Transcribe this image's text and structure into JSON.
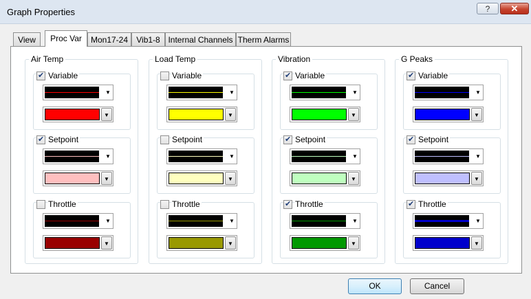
{
  "window": {
    "title": "Graph Properties",
    "help_glyph": "?",
    "close_glyph": "✕"
  },
  "tabs": [
    {
      "label": "View",
      "active": false
    },
    {
      "label": "Proc Var",
      "active": true
    },
    {
      "label": "Mon17-24",
      "active": false
    },
    {
      "label": "Vib1-8",
      "active": false
    },
    {
      "label": "Internal Channels",
      "active": false
    },
    {
      "label": "Therm Alarms",
      "active": false
    }
  ],
  "groups": [
    {
      "label": "Air Temp",
      "rows": [
        {
          "label": "Variable",
          "checked": true,
          "line_color": "#ff0000",
          "line_thickness": 1,
          "fill_color": "#ff0000"
        },
        {
          "label": "Setpoint",
          "checked": true,
          "line_color": "#ffbfbf",
          "line_thickness": 1,
          "fill_color": "#ffbfbf"
        },
        {
          "label": "Throttle",
          "checked": false,
          "line_color": "#990000",
          "line_thickness": 1,
          "fill_color": "#990000"
        }
      ]
    },
    {
      "label": "Load Temp",
      "rows": [
        {
          "label": "Variable",
          "checked": false,
          "line_color": "#ffff00",
          "line_thickness": 1,
          "fill_color": "#ffff00"
        },
        {
          "label": "Setpoint",
          "checked": false,
          "line_color": "#ffffbf",
          "line_thickness": 1,
          "fill_color": "#ffffbf"
        },
        {
          "label": "Throttle",
          "checked": false,
          "line_color": "#999900",
          "line_thickness": 1,
          "fill_color": "#999900"
        }
      ]
    },
    {
      "label": "Vibration",
      "rows": [
        {
          "label": "Variable",
          "checked": true,
          "line_color": "#00ff00",
          "line_thickness": 1,
          "fill_color": "#00ff00"
        },
        {
          "label": "Setpoint",
          "checked": true,
          "line_color": "#bfffbf",
          "line_thickness": 1,
          "fill_color": "#bfffbf"
        },
        {
          "label": "Throttle",
          "checked": true,
          "line_color": "#009900",
          "line_thickness": 1,
          "fill_color": "#009900"
        }
      ]
    },
    {
      "label": "G Peaks",
      "rows": [
        {
          "label": "Variable",
          "checked": true,
          "line_color": "#0000ff",
          "line_thickness": 1,
          "fill_color": "#0000ff"
        },
        {
          "label": "Setpoint",
          "checked": true,
          "line_color": "#bfbfff",
          "line_thickness": 1,
          "fill_color": "#bfbfff"
        },
        {
          "label": "Throttle",
          "checked": true,
          "line_color": "#0000cc",
          "line_thickness": 3,
          "fill_color": "#0000cc"
        }
      ]
    }
  ],
  "buttons": {
    "ok": "OK",
    "cancel": "Cancel"
  }
}
